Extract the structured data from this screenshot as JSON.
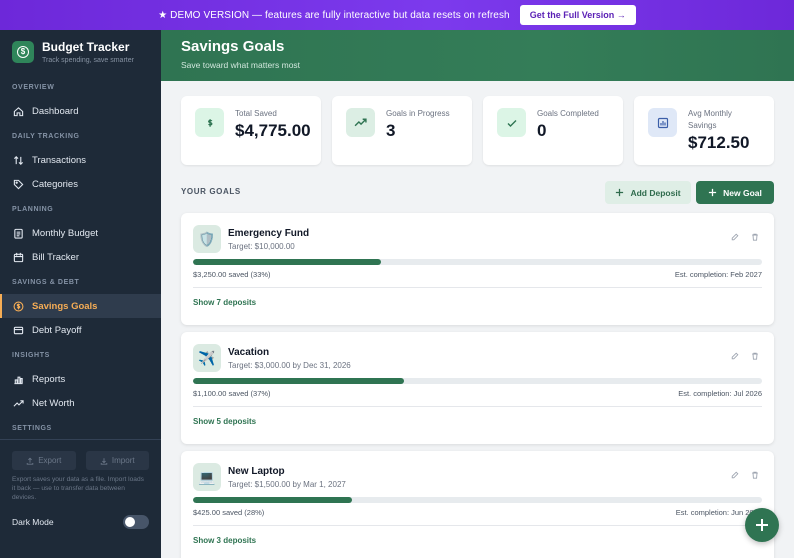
{
  "banner": {
    "text": "★ DEMO VERSION — features are fully interactive but data resets on refresh",
    "cta": "Get the Full Version →"
  },
  "brand": {
    "title": "Budget Tracker",
    "subtitle": "Track spending, save smarter"
  },
  "sidebar": {
    "sections": [
      {
        "label": "OVERVIEW",
        "items": [
          {
            "label": "Dashboard",
            "icon": "home-icon"
          }
        ]
      },
      {
        "label": "DAILY TRACKING",
        "items": [
          {
            "label": "Transactions",
            "icon": "swap-icon"
          },
          {
            "label": "Categories",
            "icon": "tag-icon"
          }
        ]
      },
      {
        "label": "PLANNING",
        "items": [
          {
            "label": "Monthly Budget",
            "icon": "clipboard-icon"
          },
          {
            "label": "Bill Tracker",
            "icon": "calendar-icon"
          }
        ]
      },
      {
        "label": "SAVINGS & DEBT",
        "items": [
          {
            "label": "Savings Goals",
            "icon": "dollar-circle-icon",
            "active": true
          },
          {
            "label": "Debt Payoff",
            "icon": "card-icon"
          }
        ]
      },
      {
        "label": "INSIGHTS",
        "items": [
          {
            "label": "Reports",
            "icon": "bar-chart-icon"
          },
          {
            "label": "Net Worth",
            "icon": "trend-icon"
          }
        ]
      },
      {
        "label": "SETTINGS",
        "items": []
      }
    ],
    "export_label": "Export",
    "import_label": "Import",
    "io_note": "Export saves your data as a file. Import loads it back — use to transfer data between devices.",
    "dark_mode_label": "Dark Mode"
  },
  "header": {
    "title": "Savings Goals",
    "subtitle": "Save toward what matters most"
  },
  "stats": [
    {
      "label": "Total Saved",
      "value": "$4,775.00",
      "icon": "dollar-icon",
      "color": "#dcf5e6"
    },
    {
      "label": "Goals in Progress",
      "value": "3",
      "icon": "trend-up-icon",
      "color": "#dceee4"
    },
    {
      "label": "Goals Completed",
      "value": "0",
      "icon": "check-icon",
      "color": "#dcf5e6"
    },
    {
      "label": "Avg Monthly Savings",
      "value": "$712.50",
      "icon": "bar-chart-icon",
      "color": "#dfe8f7"
    }
  ],
  "goals_section": {
    "title": "YOUR GOALS",
    "add_deposit": "Add Deposit",
    "new_goal": "New Goal"
  },
  "goals": [
    {
      "name": "Emergency Fund",
      "target": "Target: $10,000.00",
      "progress": 0.33,
      "saved": "$3,250.00 saved (33%)",
      "est": "Est. completion: Feb 2027",
      "show": "Show 7 deposits",
      "emoji": "🛡️"
    },
    {
      "name": "Vacation",
      "target": "Target: $3,000.00 by Dec 31, 2026",
      "progress": 0.37,
      "saved": "$1,100.00 saved (37%)",
      "est": "Est. completion: Jul 2026",
      "show": "Show 5 deposits",
      "emoji": "✈️"
    },
    {
      "name": "New Laptop",
      "target": "Target: $1,500.00 by Mar 1, 2027",
      "progress": 0.28,
      "saved": "$425.00 saved (28%)",
      "est": "Est. completion: Jun 2026",
      "show": "Show 3 deposits",
      "emoji": "💻"
    }
  ],
  "fab_label": "+"
}
